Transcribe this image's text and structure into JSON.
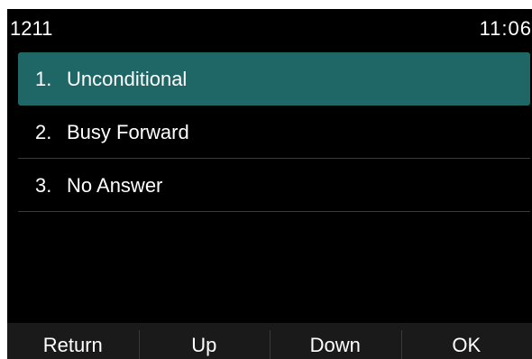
{
  "status_bar": {
    "account": "1211",
    "time": "11:06"
  },
  "menu": {
    "items": [
      {
        "number": "1.",
        "label": "Unconditional",
        "selected": true
      },
      {
        "number": "2.",
        "label": "Busy Forward",
        "selected": false
      },
      {
        "number": "3.",
        "label": "No Answer",
        "selected": false
      }
    ]
  },
  "softkeys": {
    "return_label": "Return",
    "up_label": "Up",
    "down_label": "Down",
    "ok_label": "OK"
  },
  "colors": {
    "highlight": "#1f6766",
    "background": "#000000",
    "softkey_bar": "#1a1a1a"
  }
}
